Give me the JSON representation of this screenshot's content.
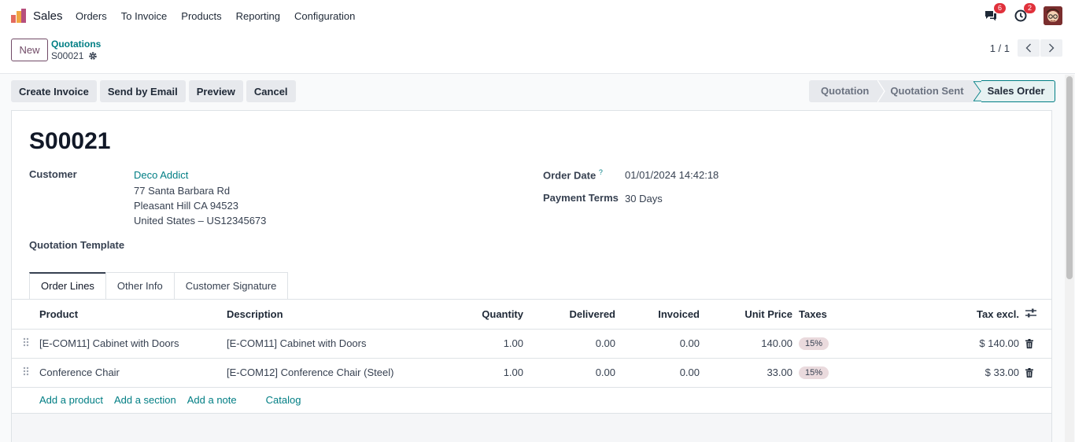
{
  "app": {
    "name": "Sales"
  },
  "nav": {
    "items": [
      "Orders",
      "To Invoice",
      "Products",
      "Reporting",
      "Configuration"
    ]
  },
  "systray": {
    "messages_count": "6",
    "activities_count": "2"
  },
  "control": {
    "new_label": "New",
    "breadcrumb_parent": "Quotations",
    "breadcrumb_current": "S00021",
    "pager_value": "1 / 1"
  },
  "actions": [
    "Create Invoice",
    "Send by Email",
    "Preview",
    "Cancel"
  ],
  "status": {
    "stages": [
      "Quotation",
      "Quotation Sent",
      "Sales Order"
    ],
    "active": "Sales Order"
  },
  "form": {
    "title": "S00021",
    "customer_label": "Customer",
    "customer_name": "Deco Addict",
    "address_line1": "77 Santa Barbara Rd",
    "address_line2": "Pleasant Hill CA 94523",
    "address_line3": "United States – US12345673",
    "template_label": "Quotation Template",
    "order_date_label": "Order Date",
    "order_date_help": "?",
    "order_date": "01/01/2024 14:42:18",
    "payment_terms_label": "Payment Terms",
    "payment_terms": "30 Days"
  },
  "tabs": [
    "Order Lines",
    "Other Info",
    "Customer Signature"
  ],
  "lines": {
    "columns": {
      "product": "Product",
      "description": "Description",
      "quantity": "Quantity",
      "delivered": "Delivered",
      "invoiced": "Invoiced",
      "unit_price": "Unit Price",
      "taxes": "Taxes",
      "subtotal": "Tax excl."
    },
    "rows": [
      {
        "product": "[E-COM11] Cabinet with Doors",
        "description": "[E-COM11] Cabinet with Doors",
        "quantity": "1.00",
        "delivered": "0.00",
        "invoiced": "0.00",
        "unit_price": "140.00",
        "tax": "15%",
        "subtotal": "$ 140.00"
      },
      {
        "product": "Conference Chair",
        "description": "[E-COM12] Conference Chair (Steel)",
        "quantity": "1.00",
        "delivered": "0.00",
        "invoiced": "0.00",
        "unit_price": "33.00",
        "tax": "15%",
        "subtotal": "$ 33.00"
      }
    ],
    "add_links": {
      "product": "Add a product",
      "section": "Add a section",
      "note": "Add a note",
      "catalog": "Catalog"
    }
  },
  "colors": {
    "brand": "#714b67",
    "link": "#017e84",
    "badge": "#e0313b"
  }
}
